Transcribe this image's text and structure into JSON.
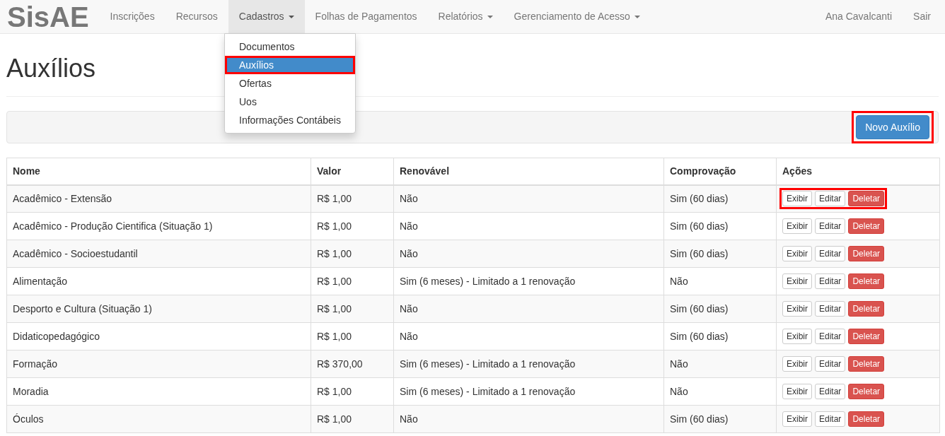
{
  "navbar": {
    "brand": "SisAE",
    "items": [
      {
        "label": "Inscrições",
        "dropdown": false,
        "selected": false
      },
      {
        "label": "Recursos",
        "dropdown": false,
        "selected": false
      },
      {
        "label": "Cadastros",
        "dropdown": true,
        "selected": true
      },
      {
        "label": "Folhas de Pagamentos",
        "dropdown": false,
        "selected": false
      },
      {
        "label": "Relatórios",
        "dropdown": true,
        "selected": false
      },
      {
        "label": "Gerenciamento de Acesso",
        "dropdown": true,
        "selected": false
      }
    ],
    "right_items": [
      "Ana Cavalcanti",
      "Sair"
    ]
  },
  "dropdown_menu": [
    {
      "label": "Documentos",
      "selected": false,
      "highlighted": false
    },
    {
      "label": "Auxílios",
      "selected": true,
      "highlighted": true
    },
    {
      "label": "Ofertas",
      "selected": false,
      "highlighted": false
    },
    {
      "label": "Uos",
      "selected": false,
      "highlighted": false
    },
    {
      "label": "Informações Contábeis",
      "selected": false,
      "highlighted": false
    }
  ],
  "page_title": "Auxílios",
  "new_button": {
    "label": "Novo Auxílio",
    "highlighted": true
  },
  "table": {
    "columns": [
      "Nome",
      "Valor",
      "Renovável",
      "Comprovação",
      "Ações"
    ],
    "rows": [
      {
        "cells": [
          "Acadêmico - Extensão",
          "R$ 1,00",
          "Não",
          "Sim (60 dias)"
        ],
        "actions": [
          "Exibir",
          "Editar",
          "Deletar"
        ],
        "actions_highlighted": true
      },
      {
        "cells": [
          "Acadêmico - Produção Cientifica (Situação 1)",
          "R$ 1,00",
          "Não",
          "Sim (60 dias)"
        ],
        "actions": [
          "Exibir",
          "Editar",
          "Deletar"
        ],
        "actions_highlighted": false
      },
      {
        "cells": [
          "Acadêmico - Socioestudantil",
          "R$ 1,00",
          "Não",
          "Sim (60 dias)"
        ],
        "actions": [
          "Exibir",
          "Editar",
          "Deletar"
        ],
        "actions_highlighted": false
      },
      {
        "cells": [
          "Alimentação",
          "R$ 1,00",
          "Sim (6 meses) - Limitado a 1 renovação",
          "Não"
        ],
        "actions": [
          "Exibir",
          "Editar",
          "Deletar"
        ],
        "actions_highlighted": false
      },
      {
        "cells": [
          "Desporto e Cultura (Situação 1)",
          "R$ 1,00",
          "Não",
          "Sim (60 dias)"
        ],
        "actions": [
          "Exibir",
          "Editar",
          "Deletar"
        ],
        "actions_highlighted": false
      },
      {
        "cells": [
          "Didaticopedagógico",
          "R$ 1,00",
          "Não",
          "Sim (60 dias)"
        ],
        "actions": [
          "Exibir",
          "Editar",
          "Deletar"
        ],
        "actions_highlighted": false
      },
      {
        "cells": [
          "Formação",
          "R$ 370,00",
          "Sim (6 meses) - Limitado a 1 renovação",
          "Não"
        ],
        "actions": [
          "Exibir",
          "Editar",
          "Deletar"
        ],
        "actions_highlighted": false
      },
      {
        "cells": [
          "Moradia",
          "R$ 1,00",
          "Sim (6 meses) - Limitado a 1 renovação",
          "Não"
        ],
        "actions": [
          "Exibir",
          "Editar",
          "Deletar"
        ],
        "actions_highlighted": false
      },
      {
        "cells": [
          "Óculos",
          "R$ 1,00",
          "Não",
          "Sim (60 dias)"
        ],
        "actions": [
          "Exibir",
          "Editar",
          "Deletar"
        ],
        "actions_highlighted": false
      }
    ]
  }
}
